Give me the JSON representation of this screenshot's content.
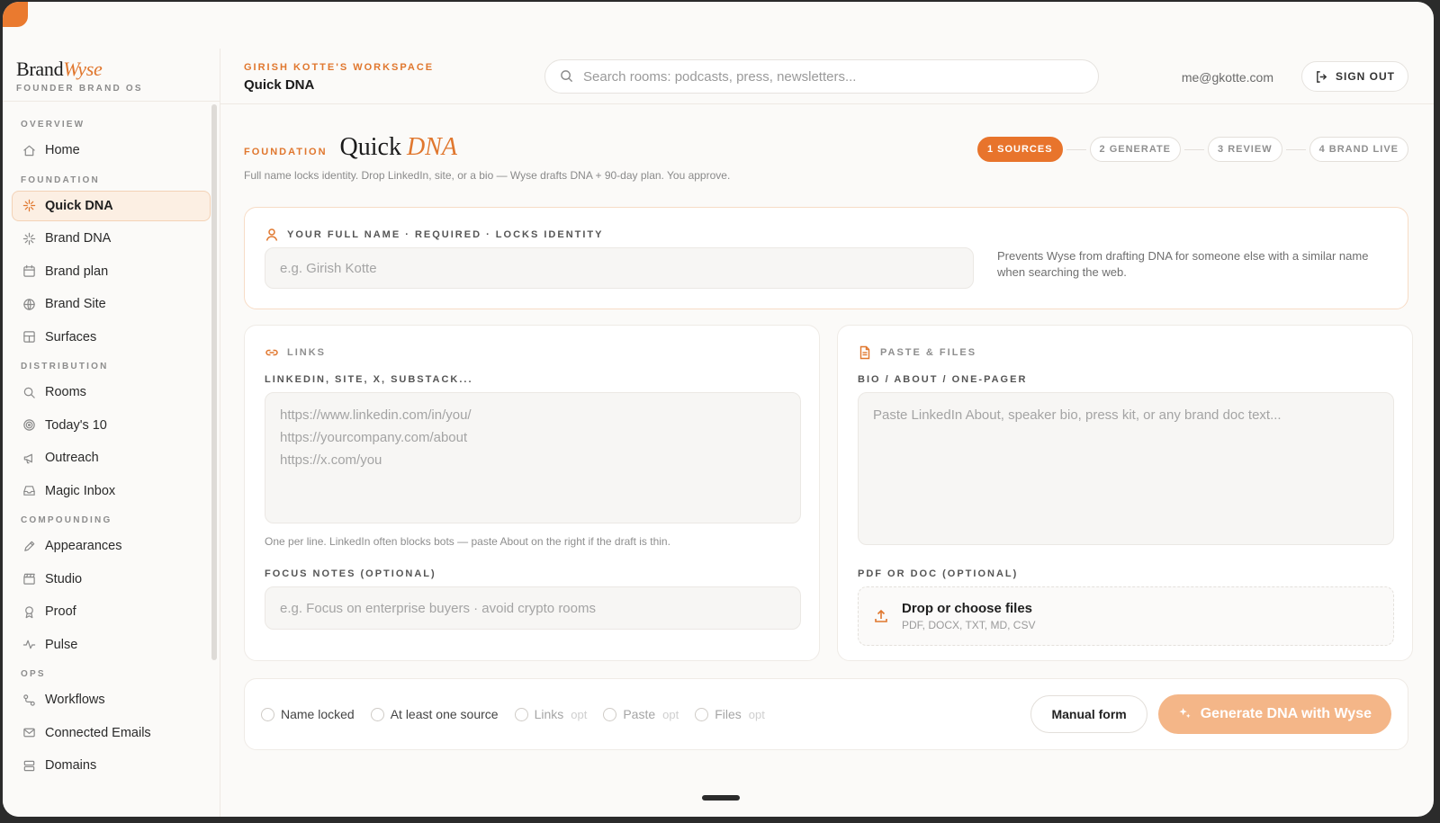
{
  "brand": {
    "name_plain": "Brand",
    "name_accent": "Wyse",
    "subtitle": "FOUNDER BRAND OS"
  },
  "sidebar": {
    "sections": [
      {
        "title": "OVERVIEW",
        "items": [
          {
            "label": "Home",
            "icon": "home-icon"
          }
        ]
      },
      {
        "title": "FOUNDATION",
        "items": [
          {
            "label": "Quick DNA",
            "icon": "sparkle-icon",
            "active": true
          },
          {
            "label": "Brand DNA",
            "icon": "sparkle-icon"
          },
          {
            "label": "Brand plan",
            "icon": "calendar-icon"
          },
          {
            "label": "Brand Site",
            "icon": "globe-icon"
          },
          {
            "label": "Surfaces",
            "icon": "layout-icon"
          }
        ]
      },
      {
        "title": "DISTRIBUTION",
        "items": [
          {
            "label": "Rooms",
            "icon": "search-icon"
          },
          {
            "label": "Today's 10",
            "icon": "target-icon"
          },
          {
            "label": "Outreach",
            "icon": "megaphone-icon"
          },
          {
            "label": "Magic Inbox",
            "icon": "inbox-icon"
          }
        ]
      },
      {
        "title": "COMPOUNDING",
        "items": [
          {
            "label": "Appearances",
            "icon": "pen-icon"
          },
          {
            "label": "Studio",
            "icon": "clapper-icon"
          },
          {
            "label": "Proof",
            "icon": "award-icon"
          },
          {
            "label": "Pulse",
            "icon": "pulse-icon"
          }
        ]
      },
      {
        "title": "OPS",
        "items": [
          {
            "label": "Workflows",
            "icon": "workflow-icon"
          },
          {
            "label": "Connected Emails",
            "icon": "mail-icon"
          },
          {
            "label": "Domains",
            "icon": "server-icon"
          }
        ]
      }
    ]
  },
  "header": {
    "workspace_label": "GIRISH KOTTE'S WORKSPACE",
    "page_title": "Quick DNA",
    "search_placeholder": "Search rooms: podcasts, press, newsletters...",
    "email": "me@gkotte.com",
    "signout_label": "SIGN OUT"
  },
  "page": {
    "kicker": "FOUNDATION",
    "title_plain": "Quick",
    "title_accent": "DNA",
    "subtitle": "Full name locks identity. Drop LinkedIn, site, or a bio — Wyse drafts DNA + 90-day plan. You approve.",
    "steps": [
      {
        "label": "1 SOURCES",
        "active": true
      },
      {
        "label": "2 GENERATE"
      },
      {
        "label": "3 REVIEW"
      },
      {
        "label": "4 BRAND LIVE"
      }
    ]
  },
  "name_card": {
    "label": "YOUR FULL NAME · REQUIRED · LOCKS IDENTITY",
    "placeholder": "e.g. Girish Kotte",
    "note": "Prevents Wyse from drafting DNA for someone else with a similar name when searching the web."
  },
  "links_card": {
    "title": "LINKS",
    "field_label": "LINKEDIN, SITE, X, SUBSTACK...",
    "placeholder_lines": [
      "https://www.linkedin.com/in/you/",
      "https://yourcompany.com/about",
      "https://x.com/you"
    ],
    "hint": "One per line. LinkedIn often blocks bots — paste About on the right if the draft is thin.",
    "focus_label": "FOCUS NOTES (OPTIONAL)",
    "focus_placeholder": "e.g. Focus on enterprise buyers · avoid crypto rooms"
  },
  "paste_card": {
    "title": "PASTE & FILES",
    "field_label": "BIO / ABOUT / ONE-PAGER",
    "placeholder": "Paste LinkedIn About, speaker bio, press kit, or any brand doc text...",
    "file_label": "PDF OR DOC (OPTIONAL)",
    "drop_title": "Drop or choose files",
    "drop_sub": "PDF, DOCX, TXT, MD, CSV"
  },
  "checklist": [
    {
      "label": "Name locked",
      "opt": ""
    },
    {
      "label": "At least one source",
      "opt": ""
    },
    {
      "label": "Links",
      "opt": "opt"
    },
    {
      "label": "Paste",
      "opt": "opt"
    },
    {
      "label": "Files",
      "opt": "opt"
    }
  ],
  "actions": {
    "manual_label": "Manual form",
    "generate_label": "Generate DNA with Wyse"
  },
  "colors": {
    "accent": "#e0772e",
    "accent_soft": "#f4b688",
    "active_bg": "#fcefe3"
  }
}
